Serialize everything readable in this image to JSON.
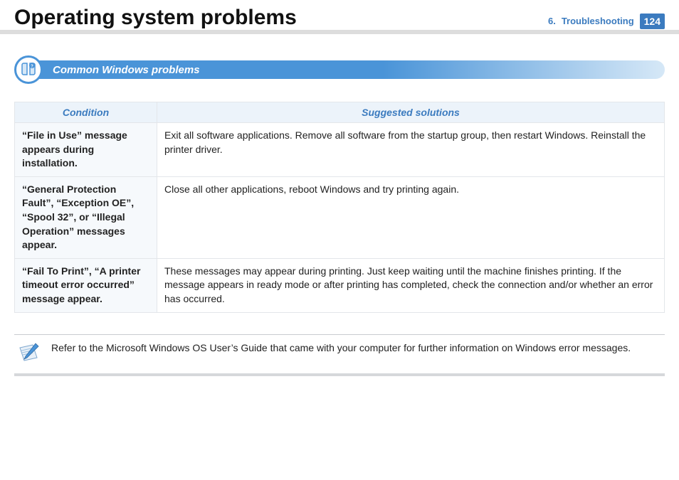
{
  "header": {
    "title": "Operating system problems",
    "breadcrumb_num": "6.",
    "breadcrumb_text": "Troubleshooting",
    "page_number": "124"
  },
  "section": {
    "title": "Common Windows problems"
  },
  "table": {
    "head_condition": "Condition",
    "head_solutions": "Suggested solutions",
    "rows": [
      {
        "condition": "“File in Use” message appears during installation.",
        "solution": "Exit all software applications. Remove all software from the startup group, then restart Windows. Reinstall the printer driver."
      },
      {
        "condition": "“General Protection Fault”, “Exception OE”, “Spool 32”, or “Illegal Operation” messages appear.",
        "solution": "Close all other applications, reboot Windows and try printing again."
      },
      {
        "condition": "“Fail To Print”, “A printer timeout error occurred” message appear.",
        "solution": "These messages may appear during printing. Just keep waiting until the machine finishes printing. If the message appears in ready mode or after printing has completed, check the connection and/or whether an error has occurred."
      }
    ]
  },
  "note": {
    "text": "Refer to the Microsoft Windows OS User’s Guide that came with your computer for further information on Windows error messages."
  }
}
